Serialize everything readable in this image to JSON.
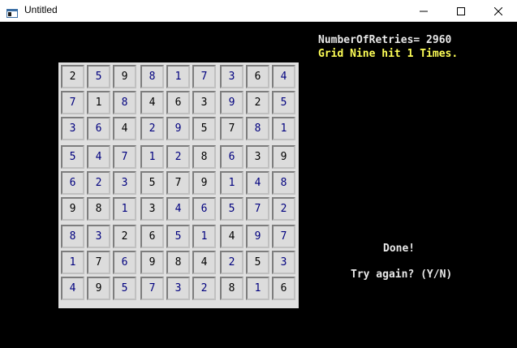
{
  "window": {
    "title": "Untitled",
    "icons": {
      "app": "console-app-icon",
      "minimize": "minimize-icon",
      "maximize": "maximize-icon",
      "close": "close-icon"
    }
  },
  "console": {
    "retries_line": "NumberOfRetries= 2960",
    "hit_line": "Grid Nine hit 1 Times.",
    "done": "Done!",
    "prompt": "Try again? (Y/N)"
  },
  "colors": {
    "background": "#000000",
    "text": "#e8e8e8",
    "highlight": "#ffff57",
    "given_digit": "#000000",
    "solved_digit": "#00007f",
    "board": "#e0e0e0"
  },
  "sudoku": {
    "rows": [
      [
        2,
        5,
        9,
        8,
        1,
        7,
        3,
        6,
        4
      ],
      [
        7,
        1,
        8,
        4,
        6,
        3,
        9,
        2,
        5
      ],
      [
        3,
        6,
        4,
        2,
        9,
        5,
        7,
        8,
        1
      ],
      [
        5,
        4,
        7,
        1,
        2,
        8,
        6,
        3,
        9
      ],
      [
        6,
        2,
        3,
        5,
        7,
        9,
        1,
        4,
        8
      ],
      [
        9,
        8,
        1,
        3,
        4,
        6,
        5,
        7,
        2
      ],
      [
        8,
        3,
        2,
        6,
        5,
        1,
        4,
        9,
        7
      ],
      [
        1,
        7,
        6,
        9,
        8,
        4,
        2,
        5,
        3
      ],
      [
        4,
        9,
        5,
        7,
        3,
        2,
        8,
        1,
        6
      ]
    ],
    "given": [
      [
        1,
        0,
        1,
        0,
        0,
        0,
        0,
        1,
        0
      ],
      [
        0,
        1,
        0,
        1,
        1,
        1,
        0,
        1,
        0
      ],
      [
        0,
        0,
        1,
        0,
        0,
        1,
        1,
        0,
        0
      ],
      [
        0,
        0,
        0,
        0,
        0,
        1,
        0,
        1,
        1
      ],
      [
        0,
        0,
        0,
        1,
        1,
        1,
        0,
        0,
        0
      ],
      [
        1,
        1,
        0,
        1,
        0,
        0,
        0,
        0,
        0
      ],
      [
        0,
        0,
        1,
        1,
        0,
        0,
        1,
        0,
        0
      ],
      [
        0,
        1,
        0,
        1,
        1,
        1,
        0,
        1,
        0
      ],
      [
        0,
        1,
        0,
        0,
        0,
        0,
        1,
        0,
        1
      ]
    ]
  }
}
